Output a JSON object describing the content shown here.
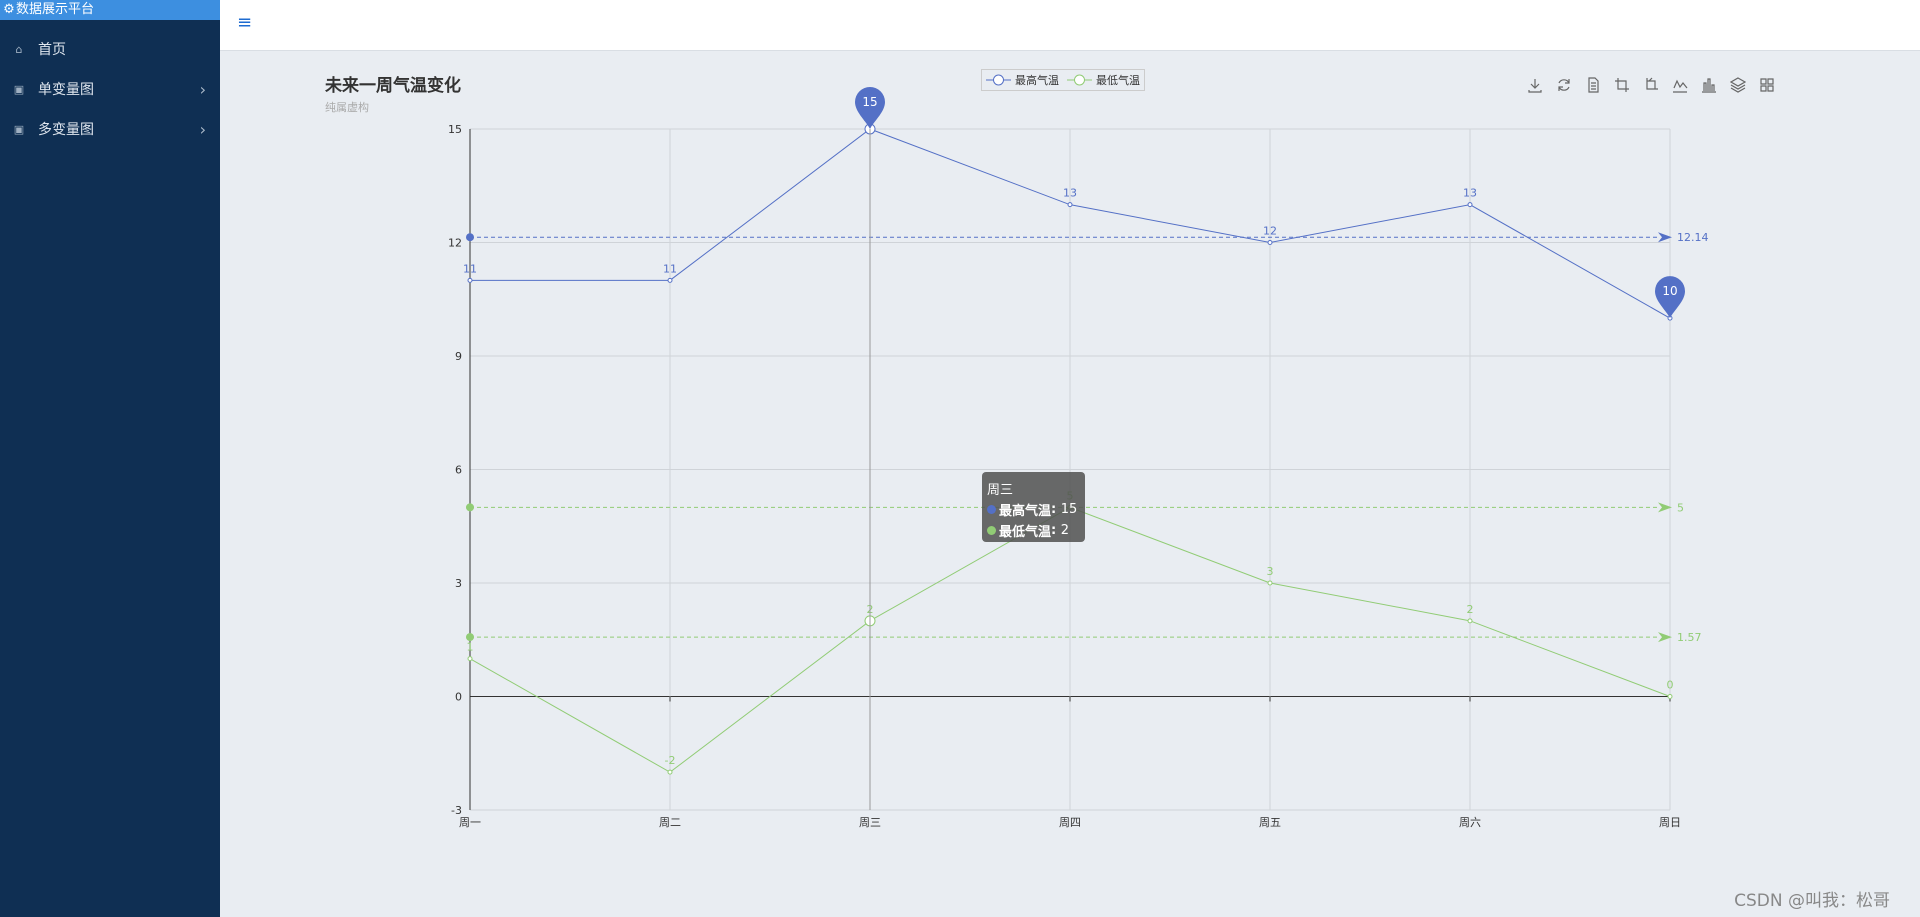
{
  "sidebar": {
    "brand": "数据展示平台",
    "items": [
      {
        "label": "首页",
        "has_submenu": false
      },
      {
        "label": "单变量图",
        "has_submenu": true
      },
      {
        "label": "多变量图",
        "has_submenu": true
      }
    ]
  },
  "topbar": {
    "menu_icon": "hamburger-icon"
  },
  "toolbox": {
    "icons": [
      "download-icon",
      "refresh-icon",
      "data-view-icon",
      "zoom-icon",
      "zoom-reset-icon",
      "line-chart-icon",
      "bar-chart-icon",
      "stack-icon",
      "tiled-icon"
    ]
  },
  "tooltip": {
    "title": "周三",
    "rows": [
      {
        "name": "最高气温",
        "value": "15"
      },
      {
        "name": "最低气温",
        "value": "2"
      }
    ]
  },
  "watermark": "CSDN @叫我：松哥",
  "colors": {
    "high": "#5470c6",
    "low": "#91cc75"
  },
  "chart_data": {
    "type": "line",
    "title": "未来一周气温变化",
    "subtitle": "纯属虚构",
    "categories": [
      "周一",
      "周二",
      "周三",
      "周四",
      "周五",
      "周六",
      "周日"
    ],
    "ylim": [
      -3,
      15
    ],
    "yticks": [
      -3,
      0,
      3,
      6,
      9,
      12,
      15
    ],
    "grid": true,
    "legend_position": "top-center",
    "series": [
      {
        "name": "最高气温",
        "values": [
          11,
          11,
          15,
          13,
          12,
          13,
          10
        ],
        "mark_points": [
          {
            "value": 15,
            "category": "周三"
          },
          {
            "value": 10,
            "category": "周日"
          }
        ],
        "mark_lines": [
          {
            "value": 12.14,
            "label": "12.14"
          }
        ]
      },
      {
        "name": "最低气温",
        "values": [
          1,
          -2,
          2,
          5,
          3,
          2,
          0
        ],
        "mark_lines": [
          {
            "value": 5,
            "label": "5"
          },
          {
            "value": 1.57,
            "label": "1.57"
          }
        ]
      }
    ]
  }
}
